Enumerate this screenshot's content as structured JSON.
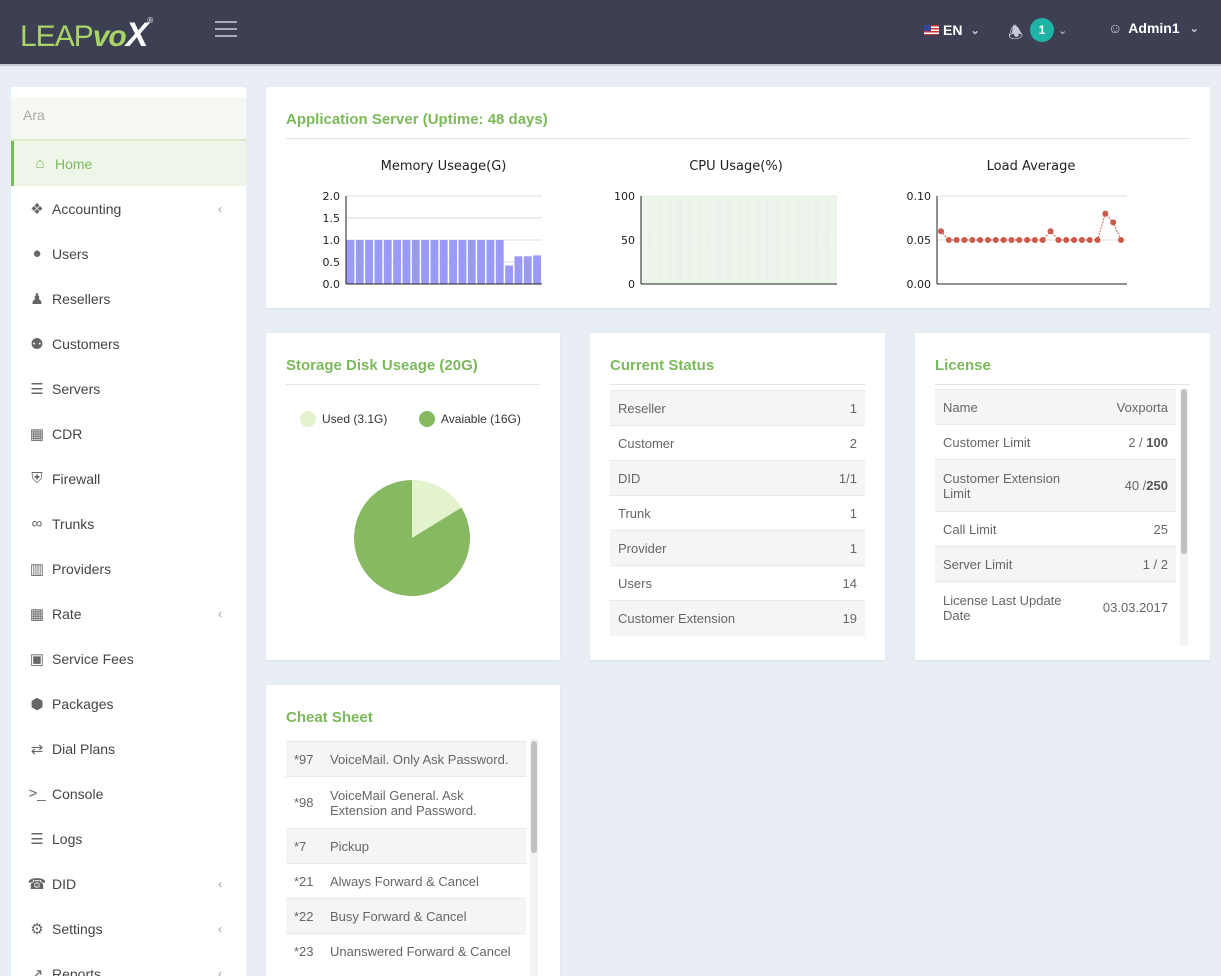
{
  "header": {
    "logo_leap": "LEAP",
    "logo_vo": "vo",
    "logo_x": "X",
    "logo_reg": "®",
    "language": "EN",
    "notifications_count": "1",
    "user_name": "Admin1"
  },
  "sidebar": {
    "search_placeholder": "Ara",
    "items": [
      {
        "label": "Home",
        "icon": "home-icon"
      },
      {
        "label": "Accounting",
        "icon": "cubes-icon"
      },
      {
        "label": "Users",
        "icon": "user-icon"
      },
      {
        "label": "Resellers",
        "icon": "user-tie-icon"
      },
      {
        "label": "Customers",
        "icon": "users-icon"
      },
      {
        "label": "Servers",
        "icon": "server-icon"
      },
      {
        "label": "CDR",
        "icon": "calculator-icon"
      },
      {
        "label": "Firewall",
        "icon": "shield-icon"
      },
      {
        "label": "Trunks",
        "icon": "link-icon"
      },
      {
        "label": "Providers",
        "icon": "building-icon"
      },
      {
        "label": "Rate",
        "icon": "table-icon"
      },
      {
        "label": "Service Fees",
        "icon": "money-icon"
      },
      {
        "label": "Packages",
        "icon": "cube-icon"
      },
      {
        "label": "Dial Plans",
        "icon": "random-icon"
      },
      {
        "label": "Console",
        "icon": "terminal-icon"
      },
      {
        "label": "Logs",
        "icon": "list-icon"
      },
      {
        "label": "DID",
        "icon": "phone-icon"
      },
      {
        "label": "Settings",
        "icon": "gear-icon"
      },
      {
        "label": "Reports",
        "icon": "line-chart-icon"
      }
    ]
  },
  "app_server": {
    "title": "Application Server (Uptime: 48 days)",
    "memory_title": "Memory Useage(G)",
    "cpu_title": "CPU Usage(%)",
    "load_title": "Load Average"
  },
  "storage": {
    "title": "Storage Disk Useage (20G)",
    "legend_used": "Used (3.1G)",
    "legend_available": "Avaiable (16G)"
  },
  "current_status": {
    "title": "Current Status",
    "rows": [
      {
        "label": "Reseller",
        "value": "1"
      },
      {
        "label": "Customer",
        "value": "2"
      },
      {
        "label": "DID",
        "value": "1/1"
      },
      {
        "label": "Trunk",
        "value": "1"
      },
      {
        "label": "Provider",
        "value": "1"
      },
      {
        "label": "Users",
        "value": "14"
      },
      {
        "label": "Customer Extension",
        "value": "19"
      }
    ]
  },
  "license": {
    "title": "License",
    "rows": [
      {
        "label": "Name",
        "value": "Voxporta"
      },
      {
        "label": "Customer Limit",
        "value_a": "2 / ",
        "value_b": "100"
      },
      {
        "label": "Customer Extension Limit",
        "value_a": "40 /",
        "value_b": "250"
      },
      {
        "label": "Call Limit",
        "value": "25"
      },
      {
        "label": "Server Limit",
        "value": "1 / 2"
      },
      {
        "label": "License Last Update Date",
        "value": "03.03.2017"
      }
    ]
  },
  "cheat_sheet": {
    "title": "Cheat Sheet",
    "rows": [
      {
        "code": "*97",
        "desc": "VoiceMail. Only Ask Password."
      },
      {
        "code": "*98",
        "desc": "VoiceMail General. Ask Extension and Password."
      },
      {
        "code": "*7",
        "desc": "Pickup"
      },
      {
        "code": "*21",
        "desc": "Always Forward & Cancel"
      },
      {
        "code": "*22",
        "desc": "Busy Forward & Cancel"
      },
      {
        "code": "*23",
        "desc": "Unanswered Forward & Cancel"
      }
    ]
  },
  "chart_data": [
    {
      "type": "bar",
      "title": "Memory Useage(G)",
      "ylim": [
        0,
        2.0
      ],
      "yticks": [
        "0.0",
        "0.5",
        "1.0",
        "1.5",
        "2.0"
      ],
      "values": [
        1.0,
        1.0,
        1.0,
        1.0,
        1.0,
        1.0,
        1.0,
        1.0,
        1.0,
        1.0,
        1.0,
        1.0,
        1.0,
        1.0,
        1.0,
        1.0,
        1.0,
        0.42,
        0.63,
        0.63,
        0.65
      ],
      "color": "#9b9bf7",
      "grid": true
    },
    {
      "type": "bar",
      "title": "CPU Usage(%)",
      "ylim": [
        0,
        100
      ],
      "yticks": [
        "0",
        "50",
        "100"
      ],
      "values": [
        100,
        100,
        100,
        100,
        100,
        100,
        100,
        100,
        100,
        100,
        100,
        100,
        100,
        100,
        100,
        100,
        100,
        100,
        100,
        100
      ],
      "color": "#eef5ec",
      "grid": true
    },
    {
      "type": "line",
      "title": "Load Average",
      "ylim": [
        0,
        0.1
      ],
      "yticks": [
        "0.00",
        "0.05",
        "0.10"
      ],
      "values": [
        0.06,
        0.05,
        0.05,
        0.05,
        0.05,
        0.05,
        0.05,
        0.05,
        0.05,
        0.05,
        0.05,
        0.05,
        0.05,
        0.05,
        0.06,
        0.05,
        0.05,
        0.05,
        0.05,
        0.05,
        0.05,
        0.08,
        0.07,
        0.05
      ],
      "color": "#cc5a4b",
      "grid": true
    },
    {
      "type": "pie",
      "title": "Storage Disk Useage (20G)",
      "slices": [
        {
          "name": "Used (3.1G)",
          "value": 3.1,
          "color": "#e3f3cd"
        },
        {
          "name": "Avaiable (16G)",
          "value": 16,
          "color": "#86b961"
        }
      ],
      "legend": "top"
    }
  ]
}
